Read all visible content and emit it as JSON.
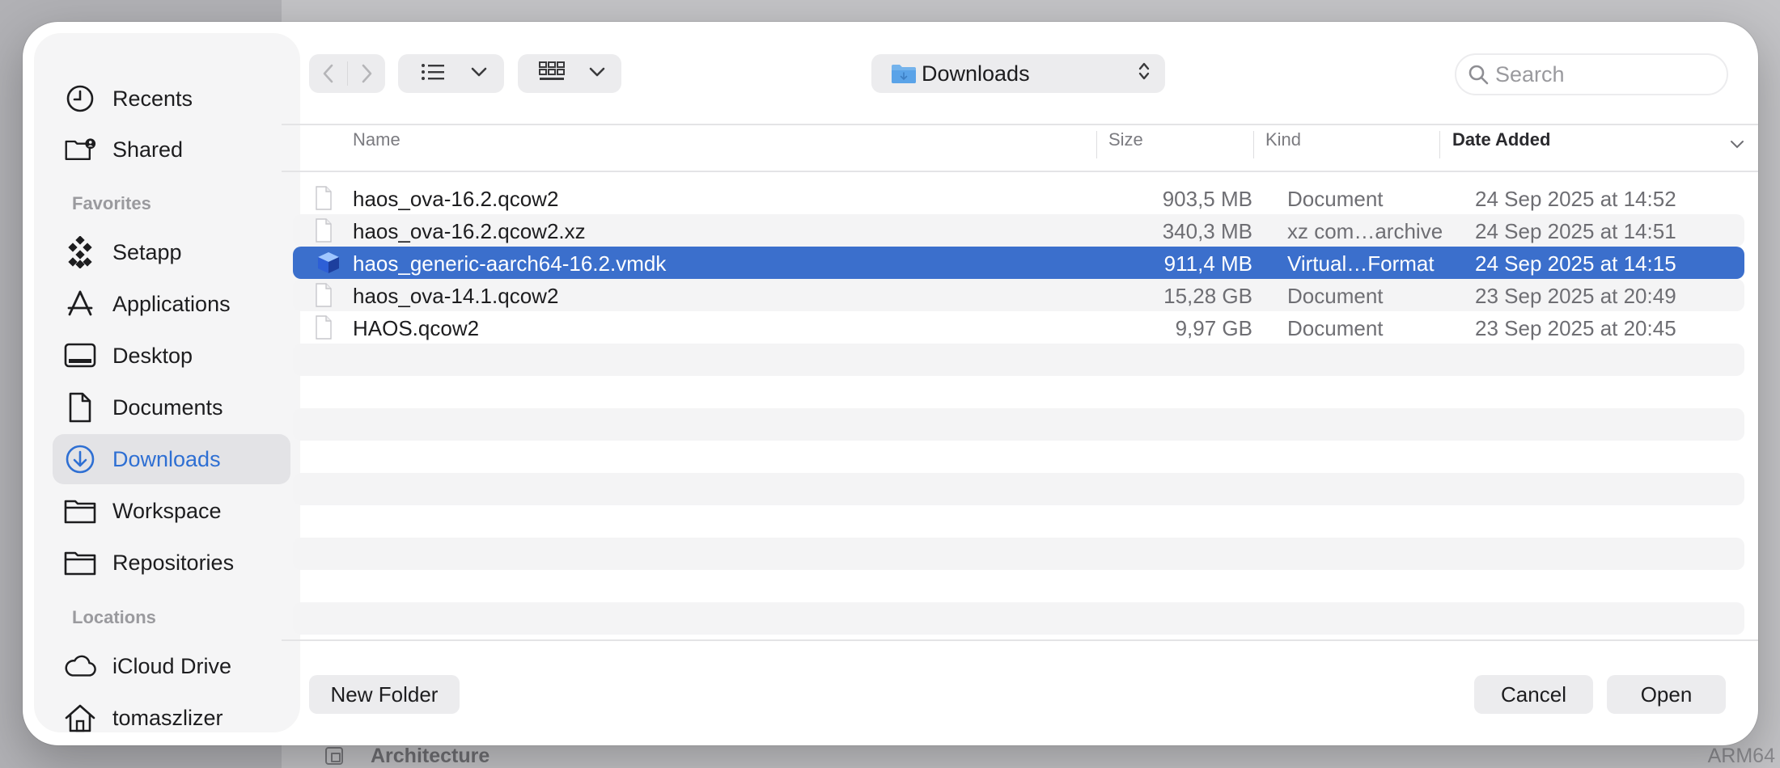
{
  "background": {
    "row_label": "Architecture",
    "row_value": "ARM64"
  },
  "sidebar": {
    "top_items": [
      {
        "label": "Recents",
        "icon": "clock-icon"
      },
      {
        "label": "Shared",
        "icon": "shared-folder-icon"
      }
    ],
    "favorites_title": "Favorites",
    "favorites": [
      {
        "label": "Setapp",
        "icon": "setapp-icon"
      },
      {
        "label": "Applications",
        "icon": "applications-icon"
      },
      {
        "label": "Desktop",
        "icon": "desktop-icon"
      },
      {
        "label": "Documents",
        "icon": "document-icon"
      },
      {
        "label": "Downloads",
        "icon": "downloads-icon",
        "active": true
      },
      {
        "label": "Workspace",
        "icon": "folder-icon"
      },
      {
        "label": "Repositories",
        "icon": "folder-icon"
      }
    ],
    "locations_title": "Locations",
    "locations": [
      {
        "label": "iCloud Drive",
        "icon": "cloud-icon"
      },
      {
        "label": "tomaszlizer",
        "icon": "home-icon"
      }
    ]
  },
  "toolbar": {
    "location": "Downloads",
    "search_placeholder": "Search"
  },
  "columns": {
    "name": "Name",
    "size": "Size",
    "kind": "Kind",
    "date_added": "Date Added"
  },
  "files": [
    {
      "name": "haos_ova-16.2.qcow2",
      "size": "903,5 MB",
      "kind": "Document",
      "date": "24 Sep 2025 at 14:52",
      "icon": "document-file-icon"
    },
    {
      "name": "haos_ova-16.2.qcow2.xz",
      "size": "340,3 MB",
      "kind": "xz com…archive",
      "date": "24 Sep 2025 at 14:51",
      "icon": "document-file-icon"
    },
    {
      "name": "haos_generic-aarch64-16.2.vmdk",
      "size": "911,4 MB",
      "kind": "Virtual…Format",
      "date": "24 Sep 2025 at 14:15",
      "icon": "virtual-disk-icon",
      "selected": true
    },
    {
      "name": "haos_ova-14.1.qcow2",
      "size": "15,28 GB",
      "kind": "Document",
      "date": "23 Sep 2025 at 20:49",
      "icon": "document-file-icon"
    },
    {
      "name": "HAOS.qcow2",
      "size": "9,97 GB",
      "kind": "Document",
      "date": "23 Sep 2025 at 20:45",
      "icon": "document-file-icon"
    }
  ],
  "buttons": {
    "new_folder": "New Folder",
    "cancel": "Cancel",
    "open": "Open"
  },
  "colors": {
    "accent": "#3b6fcc",
    "sidebar_active_text": "#2e6fd3"
  }
}
